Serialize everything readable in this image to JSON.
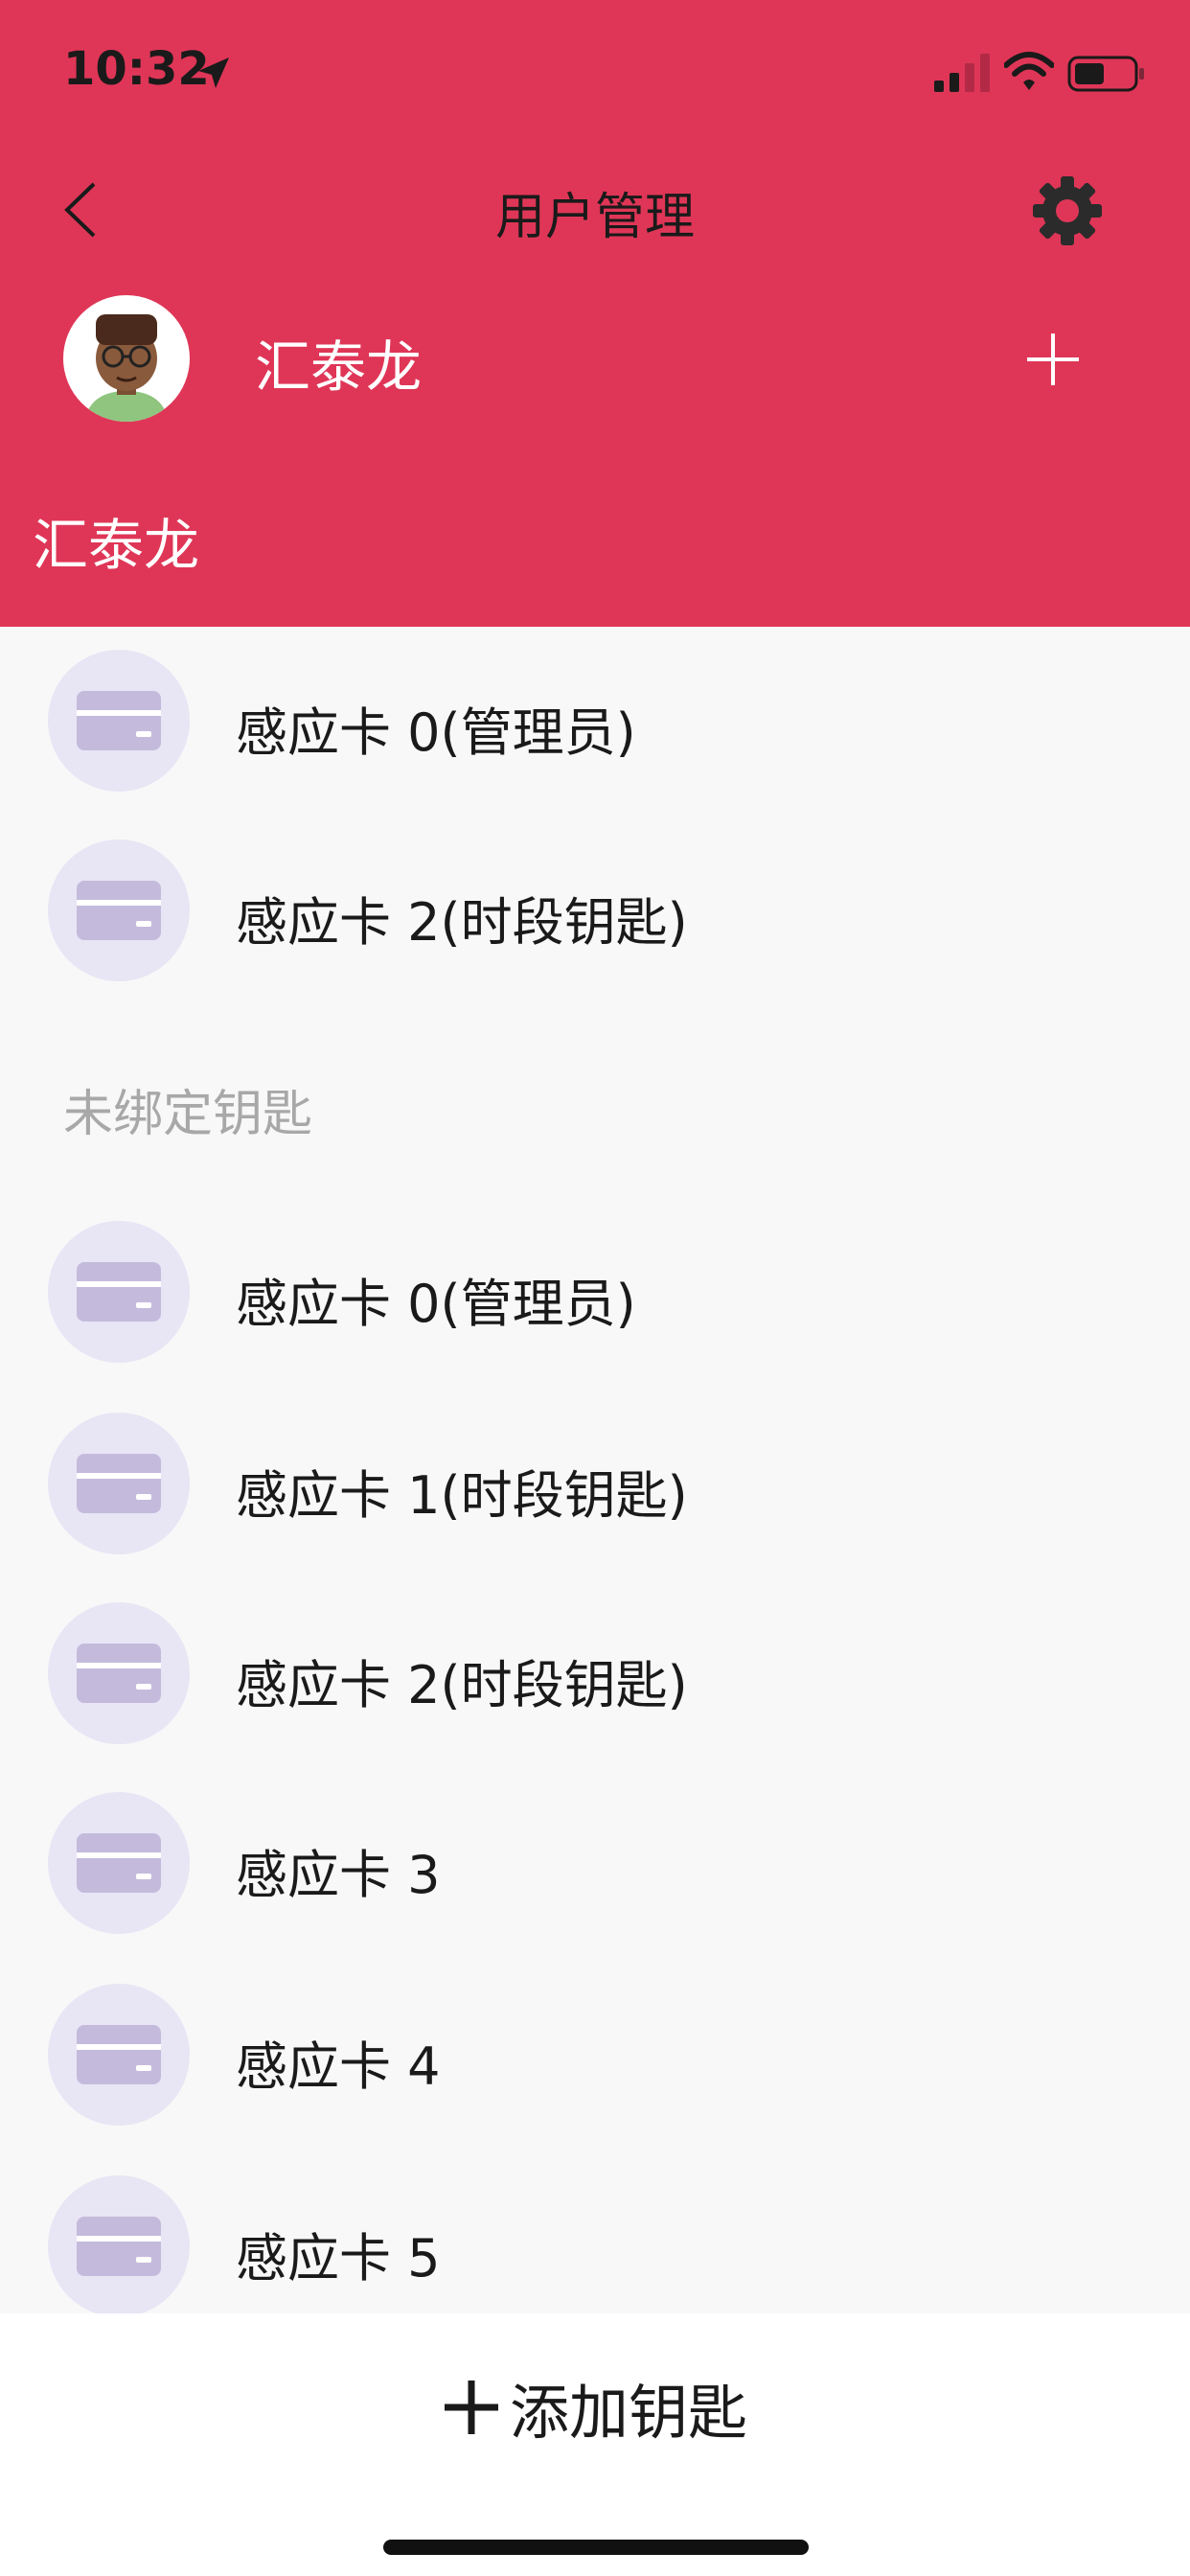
{
  "status_bar": {
    "time": "10:32"
  },
  "nav": {
    "title": "用户管理"
  },
  "user": {
    "name": "汇泰龙"
  },
  "section": {
    "title": "汇泰龙"
  },
  "bound_keys": [
    {
      "label": "感应卡 0(管理员)"
    },
    {
      "label": "感应卡 2(时段钥匙)"
    }
  ],
  "unbound_section": {
    "title": "未绑定钥匙"
  },
  "unbound_keys": [
    {
      "label": "感应卡 0(管理员)"
    },
    {
      "label": "感应卡 1(时段钥匙)"
    },
    {
      "label": "感应卡 2(时段钥匙)"
    },
    {
      "label": "感应卡 3"
    },
    {
      "label": "感应卡 4"
    },
    {
      "label": "感应卡 5"
    }
  ],
  "footer": {
    "add_key_label": "添加钥匙"
  },
  "colors": {
    "header": "#df3657",
    "icon_circle": "#e8e5f5",
    "card_icon": "#c4bbdc"
  },
  "icons": {
    "location": "location-arrow-icon",
    "signal": "cellular-signal-icon",
    "wifi": "wifi-icon",
    "battery": "battery-icon",
    "back": "chevron-left-icon",
    "settings": "gear-icon",
    "add_user": "plus-icon",
    "card": "card-icon",
    "add_key": "plus-icon"
  }
}
